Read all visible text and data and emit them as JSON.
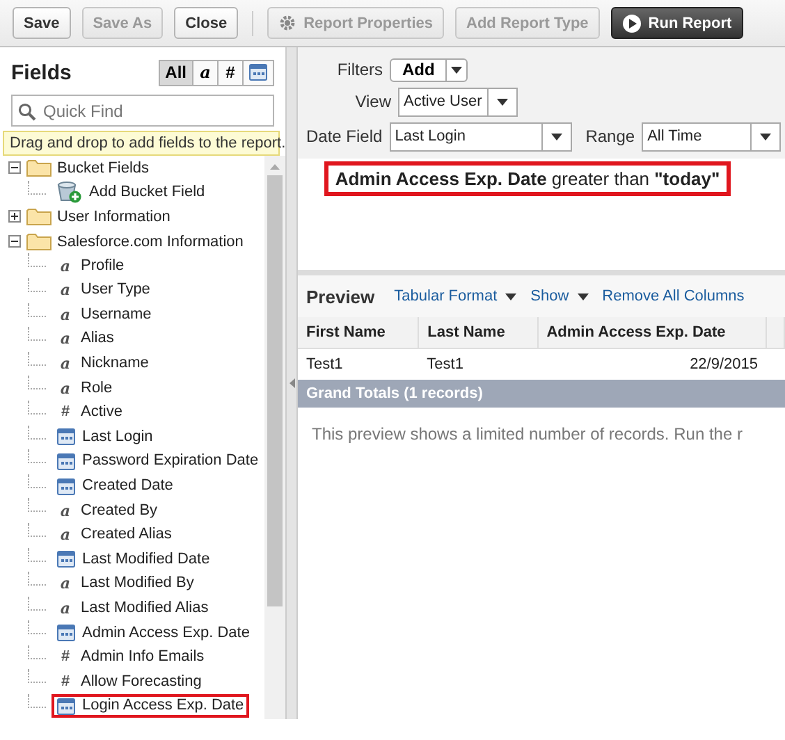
{
  "toolbar": {
    "buttons": [
      {
        "label": "Save",
        "kind": "plain",
        "disabled": false
      },
      {
        "label": "Save As",
        "kind": "plain",
        "disabled": true
      },
      {
        "label": "Close",
        "kind": "plain",
        "disabled": false
      },
      {
        "label": "Report Properties",
        "kind": "gear",
        "disabled": true
      },
      {
        "label": "Add Report Type",
        "kind": "plain",
        "disabled": true
      },
      {
        "label": "Run Report",
        "kind": "run",
        "disabled": false
      }
    ]
  },
  "fields_panel": {
    "title": "Fields",
    "type_filters": [
      {
        "label": "All",
        "kind": "text",
        "selected": true
      },
      {
        "label": "a",
        "kind": "text",
        "selected": false
      },
      {
        "label": "#",
        "kind": "text",
        "selected": false
      },
      {
        "kind": "date",
        "selected": false
      }
    ],
    "search": {
      "placeholder": "Quick Find"
    },
    "hint": "Drag and drop to add fields to the report.",
    "tree": [
      {
        "label": "Bucket Fields",
        "expanded": true,
        "children": [
          {
            "label": "Add Bucket Field",
            "kind": "bucket",
            "highlighted": false
          }
        ]
      },
      {
        "label": "User Information",
        "expanded": false
      },
      {
        "label": "Salesforce.com Information",
        "expanded": true,
        "children": [
          {
            "label": "Profile",
            "kind": "text",
            "glyph": "a",
            "highlighted": false
          },
          {
            "label": "User Type",
            "kind": "text",
            "glyph": "a",
            "highlighted": false
          },
          {
            "label": "Username",
            "kind": "text",
            "glyph": "a",
            "highlighted": false
          },
          {
            "label": "Alias",
            "kind": "text",
            "glyph": "a",
            "highlighted": false
          },
          {
            "label": "Nickname",
            "kind": "text",
            "glyph": "a",
            "highlighted": false
          },
          {
            "label": "Role",
            "kind": "text",
            "glyph": "a",
            "highlighted": false
          },
          {
            "label": "Active",
            "kind": "text",
            "glyph": "#",
            "highlighted": false
          },
          {
            "label": "Last Login",
            "kind": "date",
            "highlighted": false
          },
          {
            "label": "Password Expiration Date",
            "kind": "date",
            "highlighted": false
          },
          {
            "label": "Created Date",
            "kind": "date",
            "highlighted": false
          },
          {
            "label": "Created By",
            "kind": "text",
            "glyph": "a",
            "highlighted": false
          },
          {
            "label": "Created Alias",
            "kind": "text",
            "glyph": "a",
            "highlighted": false
          },
          {
            "label": "Last Modified Date",
            "kind": "date",
            "highlighted": false
          },
          {
            "label": "Last Modified By",
            "kind": "text",
            "glyph": "a",
            "highlighted": false
          },
          {
            "label": "Last Modified Alias",
            "kind": "text",
            "glyph": "a",
            "highlighted": false
          },
          {
            "label": "Admin Access Exp. Date",
            "kind": "date",
            "highlighted": false
          },
          {
            "label": "Admin Info Emails",
            "kind": "text",
            "glyph": "#",
            "highlighted": false
          },
          {
            "label": "Allow Forecasting",
            "kind": "text",
            "glyph": "#",
            "highlighted": false
          },
          {
            "label": "Login Access Exp. Date",
            "kind": "date",
            "highlighted": true
          }
        ]
      }
    ]
  },
  "filters": {
    "filters_label": "Filters",
    "add_button": "Add",
    "view_label": "View",
    "view_value": "Active User",
    "date_field_label": "Date Field",
    "date_field_value": "Last Login",
    "range_label": "Range",
    "range_value": "All Time",
    "criteria": [
      {
        "text": "**Admin Access Exp. Date** greater than **\"today\"**",
        "highlighted": true
      }
    ]
  },
  "preview": {
    "title": "Preview",
    "links": [
      {
        "label": "Tabular Format",
        "dropdown": true
      },
      {
        "label": "Show",
        "dropdown": true
      },
      {
        "label": "Remove All Columns",
        "dropdown": false
      }
    ],
    "columns": [
      "First Name",
      "Last Name",
      "Admin Access Exp. Date"
    ],
    "rows": [
      [
        "Test1",
        "Test1",
        "22/9/2015"
      ]
    ],
    "grand_totals": "Grand Totals (1 records)",
    "message": "This preview shows a limited number of records. Run the r"
  }
}
